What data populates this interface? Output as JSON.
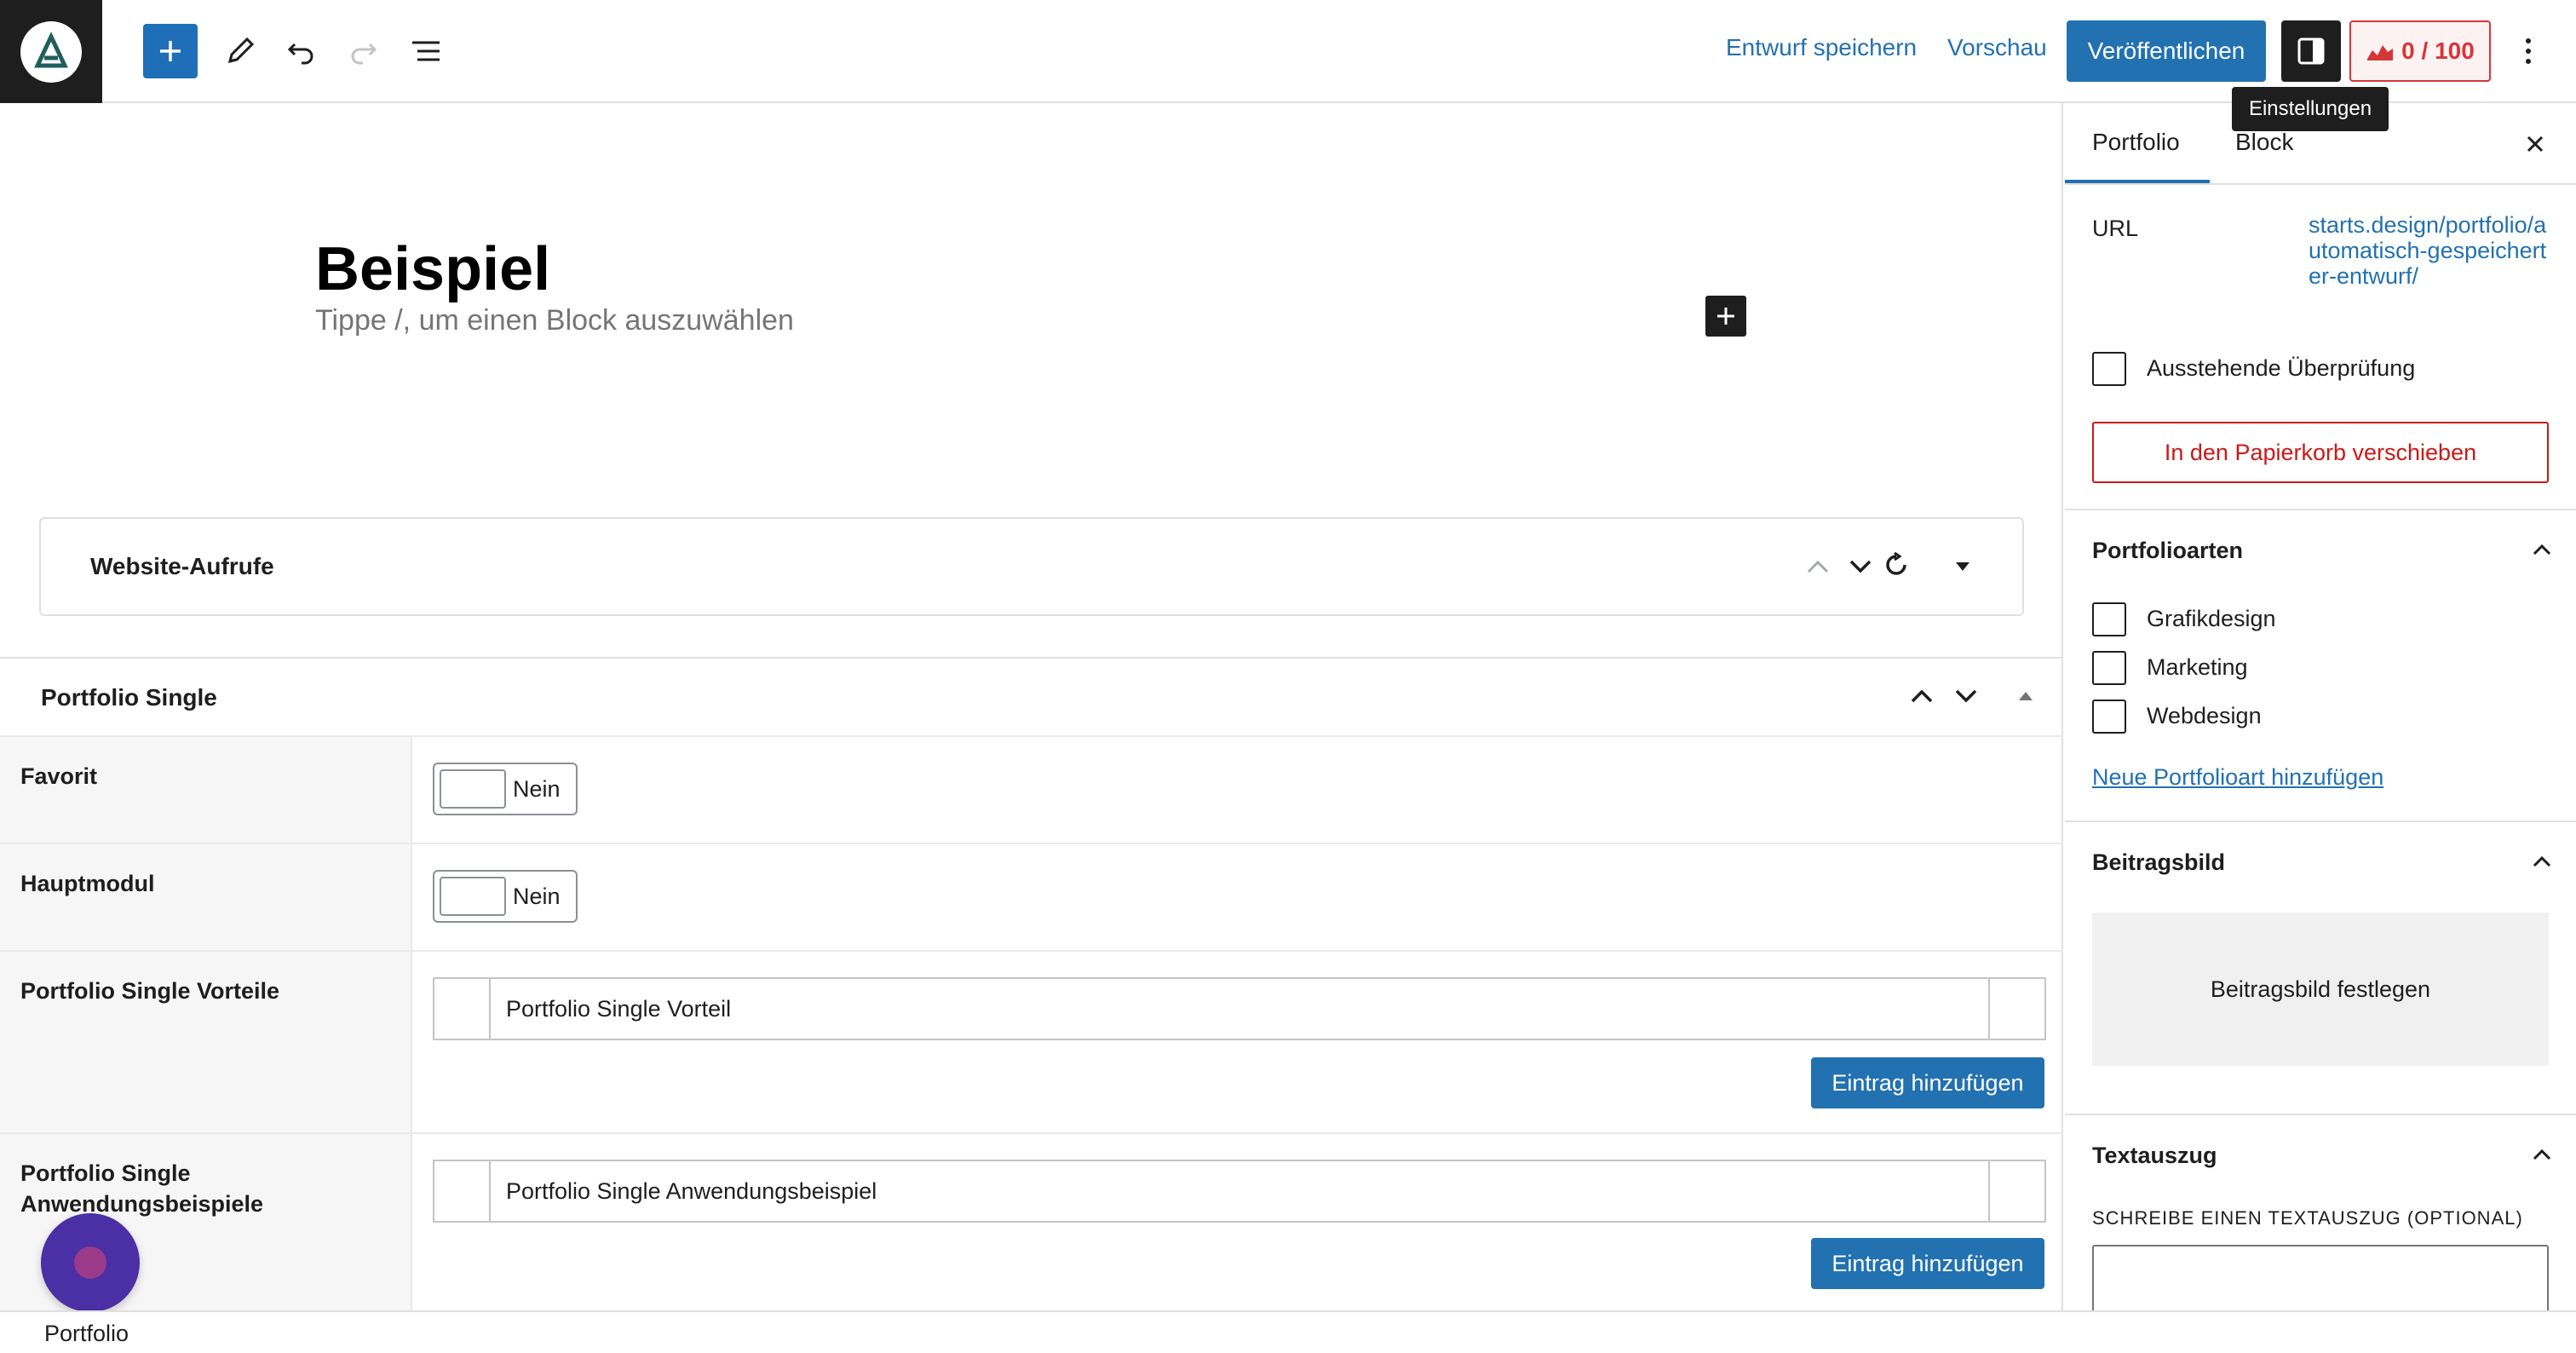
{
  "toolbar": {
    "save_draft": "Entwurf speichern",
    "preview": "Vorschau",
    "publish": "Veröffentlichen",
    "score": "0 / 100",
    "settings_tooltip": "Einstellungen"
  },
  "editor": {
    "title": "Beispiel",
    "block_placeholder": "Tippe /, um einen Block auszuwählen",
    "panel_card_title": "Website-Aufrufe"
  },
  "metabox": {
    "title": "Portfolio Single",
    "fields": [
      {
        "label": "Favorit",
        "value": "Nein"
      },
      {
        "label": "Hauptmodul",
        "value": "Nein"
      },
      {
        "label": "Portfolio Single Vorteile",
        "item": "Portfolio Single Vorteil",
        "button": "Eintrag hinzufügen"
      },
      {
        "label": "Portfolio Single Anwendungsbeispiele",
        "item": "Portfolio Single Anwendungsbeispiel",
        "button": "Eintrag hinzufügen"
      }
    ]
  },
  "footer": {
    "breadcrumb": "Portfolio"
  },
  "sidebar": {
    "tabs": [
      "Portfolio",
      "Block"
    ],
    "url_label": "URL",
    "url_value": "starts.design/portfolio/automatisch-gespeicherter-entwurf/",
    "pending_review": "Ausstehende Überprüfung",
    "trash_button": "In den Papierkorb verschieben",
    "types": {
      "title": "Portfolioarten",
      "items": [
        "Grafikdesign",
        "Marketing",
        "Webdesign"
      ],
      "add_link": "Neue Portfolioart hinzufügen"
    },
    "featured": {
      "title": "Beitragsbild",
      "button": "Beitragsbild festlegen"
    },
    "excerpt": {
      "title": "Textauszug",
      "label": "SCHREIBE EINEN TEXTAUSZUG (OPTIONAL)"
    }
  },
  "colors": {
    "accent": "#2271b1",
    "danger": "#cc1818",
    "dark": "#1e1e1e"
  }
}
